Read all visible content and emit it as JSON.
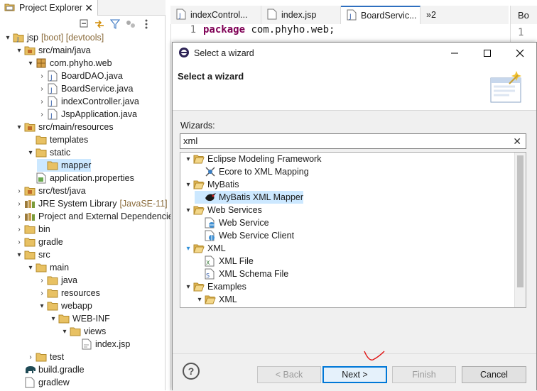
{
  "explorer": {
    "tab_label": "Project Explorer",
    "close_glyph": "✕",
    "items": [
      {
        "label": "jsp",
        "decoration": "[boot] [devtools]",
        "icon": "project-icon",
        "arrow": "▾"
      },
      {
        "label": "src/main/java",
        "decoration": "",
        "icon": "source-folder-icon",
        "arrow": "▾"
      },
      {
        "label": "com.phyho.web",
        "decoration": "",
        "icon": "package-icon",
        "arrow": "▾"
      },
      {
        "label": "BoardDAO.java",
        "decoration": "",
        "icon": "java-file-icon",
        "arrow": "›"
      },
      {
        "label": "BoardService.java",
        "decoration": "",
        "icon": "java-file-icon",
        "arrow": "›"
      },
      {
        "label": "indexController.java",
        "decoration": "",
        "icon": "java-file-icon",
        "arrow": "›"
      },
      {
        "label": "JspApplication.java",
        "decoration": "",
        "icon": "java-file-icon",
        "arrow": "›"
      },
      {
        "label": "src/main/resources",
        "decoration": "",
        "icon": "source-folder-icon",
        "arrow": "▾"
      },
      {
        "label": "templates",
        "decoration": "",
        "icon": "folder-icon",
        "arrow": ""
      },
      {
        "label": "static",
        "decoration": "",
        "icon": "folder-icon",
        "arrow": "▾"
      },
      {
        "label": "mapper",
        "decoration": "",
        "icon": "folder-icon",
        "arrow": ""
      },
      {
        "label": "application.properties",
        "decoration": "",
        "icon": "properties-file-icon",
        "arrow": ""
      },
      {
        "label": "src/test/java",
        "decoration": "",
        "icon": "source-folder-icon",
        "arrow": "›"
      },
      {
        "label": "JRE System Library",
        "decoration": "[JavaSE-11]",
        "icon": "library-icon",
        "arrow": "›"
      },
      {
        "label": "Project and External Dependencies",
        "decoration": "",
        "icon": "library-icon",
        "arrow": "›"
      },
      {
        "label": "bin",
        "decoration": "",
        "icon": "folder-icon",
        "arrow": "›"
      },
      {
        "label": "gradle",
        "decoration": "",
        "icon": "folder-icon",
        "arrow": "›"
      },
      {
        "label": "src",
        "decoration": "",
        "icon": "folder-icon",
        "arrow": "▾"
      },
      {
        "label": "main",
        "decoration": "",
        "icon": "folder-icon",
        "arrow": "▾"
      },
      {
        "label": "java",
        "decoration": "",
        "icon": "folder-icon",
        "arrow": "›"
      },
      {
        "label": "resources",
        "decoration": "",
        "icon": "folder-icon",
        "arrow": "›"
      },
      {
        "label": "webapp",
        "decoration": "",
        "icon": "folder-icon",
        "arrow": "▾"
      },
      {
        "label": "WEB-INF",
        "decoration": "",
        "icon": "folder-icon",
        "arrow": "▾"
      },
      {
        "label": "views",
        "decoration": "",
        "icon": "folder-icon",
        "arrow": "▾"
      },
      {
        "label": "index.jsp",
        "decoration": "",
        "icon": "jsp-file-icon",
        "arrow": ""
      },
      {
        "label": "test",
        "decoration": "",
        "icon": "folder-icon",
        "arrow": "›"
      },
      {
        "label": "build.gradle",
        "decoration": "",
        "icon": "gradle-elephant-icon",
        "arrow": ""
      },
      {
        "label": "gradlew",
        "decoration": "",
        "icon": "file-icon",
        "arrow": ""
      }
    ],
    "selected_index": 10
  },
  "editor": {
    "tabs": [
      "indexControl...",
      "index.jsp",
      "BoardServic...",
      "»2"
    ],
    "active_tab": 2,
    "line_number": "1",
    "keyword": "package",
    "code_rest": " com.phyho.web;",
    "right_tab_label": "Bo",
    "right_line_number": "1"
  },
  "dialog": {
    "title": "Select a wizard",
    "banner_title": "Select a wizard",
    "wizards_label": "Wizards:",
    "filter_value": "xml",
    "filter_clear_glyph": "✕",
    "tree": [
      {
        "label": "Eclipse Modeling Framework",
        "icon": "folder-open-icon",
        "arrow": "▾",
        "level": 0
      },
      {
        "label": "Ecore to XML Mapping",
        "icon": "ecore-mapping-icon",
        "arrow": "",
        "level": 1
      },
      {
        "label": "MyBatis",
        "icon": "folder-open-icon",
        "arrow": "▾",
        "level": 0
      },
      {
        "label": "MyBatis XML Mapper",
        "icon": "mybatis-bird-icon",
        "arrow": "",
        "level": 1
      },
      {
        "label": "Web Services",
        "icon": "folder-open-icon",
        "arrow": "▾",
        "level": 0
      },
      {
        "label": "Web Service",
        "icon": "web-service-icon",
        "arrow": "",
        "level": 1
      },
      {
        "label": "Web Service Client",
        "icon": "web-service-client-icon",
        "arrow": "",
        "level": 1
      },
      {
        "label": "XML",
        "icon": "folder-open-icon",
        "arrow": "▾",
        "level": 0
      },
      {
        "label": "XML File",
        "icon": "xml-file-icon",
        "arrow": "",
        "level": 1
      },
      {
        "label": "XML Schema File",
        "icon": "xml-schema-icon",
        "arrow": "",
        "level": 1
      },
      {
        "label": "Examples",
        "icon": "folder-open-icon",
        "arrow": "▾",
        "level": 0
      },
      {
        "label": "XML",
        "icon": "folder-open-icon",
        "arrow": "▾",
        "level": 1
      }
    ],
    "selected_index": 3,
    "help_glyph": "?",
    "buttons": {
      "back": "< Back",
      "next": "Next >",
      "finish": "Finish",
      "cancel": "Cancel"
    }
  },
  "colors": {
    "selection": "#cce8ff",
    "accent": "#0078d7",
    "scribble": "#e01010"
  }
}
